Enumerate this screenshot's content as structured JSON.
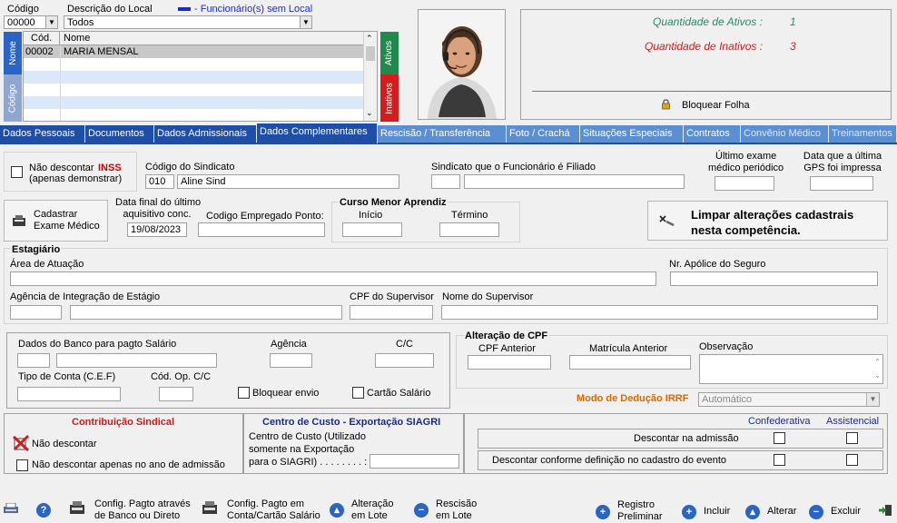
{
  "top": {
    "codigo_label": "Código",
    "codigo_value": "00000",
    "descricao_label": "Descrição do Local",
    "descricao_value": "Todos",
    "legend_text": "- Funcionário(s) sem Local",
    "legend_color": "#1a2fc8"
  },
  "grid": {
    "col_cod": "Cód.",
    "col_nome": "Nome",
    "rows": [
      {
        "cod": "00002",
        "nome": "MARIA MENSAL"
      }
    ],
    "side_tab_nome": "Nome",
    "side_tab_codigo": "Código",
    "side_tab_ativos": "Ativos",
    "side_tab_inativos": "Inativos"
  },
  "summary": {
    "ativos_label": "Quantidade de Ativos :",
    "ativos_value": "1",
    "inativos_label": "Quantidade de Inativos :",
    "inativos_value": "3",
    "bloquear_label": "Bloquear Folha"
  },
  "tabs": [
    {
      "label": "Dados Pessoais",
      "style": "dark"
    },
    {
      "label": "Documentos",
      "style": "dark"
    },
    {
      "label": "Dados Admissionais",
      "style": "dark"
    },
    {
      "label": "Dados Complementares",
      "style": "active"
    },
    {
      "label": "Rescisão / Transferência",
      "style": "light"
    },
    {
      "label": "Foto / Crachá",
      "style": "light"
    },
    {
      "label": "Situações Especiais",
      "style": "light"
    },
    {
      "label": "Contratos",
      "style": "light"
    },
    {
      "label": "Convênio Médico",
      "style": "faded"
    },
    {
      "label": "Treinamentos",
      "style": "faded"
    }
  ],
  "form": {
    "nao_descontar": "Não descontar",
    "inss": "INSS",
    "apenas_demonstrar": "(apenas demonstrar)",
    "codigo_sindicato_label": "Código do Sindicato",
    "codigo_sindicato_value": "010",
    "sindicato_nome_value": "Aline Sind",
    "sindicato_filiado_label": "Sindicato que o Funcionário é Filiado",
    "ultimo_exame_label_1": "Último exame",
    "ultimo_exame_label_2": "médico periódico",
    "gps_label_1": "Data que a última",
    "gps_label_2": "GPS foi impressa",
    "cadastrar_exame_1": "Cadastrar",
    "cadastrar_exame_2": "Exame Médico",
    "data_final_label_1": "Data final do último",
    "data_final_label_2": "aquisitivo conc.",
    "data_final_value": "19/08/2023",
    "codigo_ponto_label": "Codigo Empregado Ponto:",
    "curso_menor_label": "Curso Menor Aprendiz",
    "inicio_label": "Início",
    "termino_label": "Término",
    "limpar_1": "Limpar alterações cadastrais",
    "limpar_2": "nesta competência.",
    "estagiario_label": "Estagiário",
    "area_atuacao_label": "Área de Atuação",
    "apolice_label": "Nr. Apólice do Seguro",
    "agencia_integracao_label": "Agência de Integração de Estágio",
    "cpf_supervisor_label": "CPF do Supervisor",
    "nome_supervisor_label": "Nome do Supervisor",
    "banco_label": "Dados do Banco para pagto Salário",
    "agencia_label": "Agência",
    "cc_label": "C/C",
    "tipo_conta_label": "Tipo de Conta (C.E.F)",
    "cod_op_label": "Cód. Op. C/C",
    "bloquear_envio_label": "Bloquear envio",
    "cartao_salario_label": "Cartão Salário",
    "alteracao_cpf_label": "Alteração de CPF",
    "cpf_anterior_label": "CPF Anterior",
    "matricula_anterior_label": "Matrícula Anterior",
    "observacao_label": "Observação",
    "modo_irrf_label": "Modo de Dedução IRRF",
    "modo_irrf_value": "Automático",
    "contrib_sindical_label": "Contribuição Sindical",
    "contrib_nao_descontar": "Não descontar",
    "contrib_nao_descontar_ano": "Não descontar apenas no ano de admissão",
    "centro_custo_title": "Centro de Custo - Exportação SIAGRI",
    "centro_custo_l1": "Centro de Custo (Utilizado",
    "centro_custo_l2": "somente na Exportação",
    "centro_custo_l3": "para o SIAGRI) . . . . . . . . :",
    "confederativa_label": "Confederativa",
    "assistencial_label": "Assistencial",
    "descontar_admissao": "Descontar na admissão",
    "descontar_conforme": "Descontar conforme definição no cadastro do evento"
  },
  "toolbar": {
    "config_banco_1": "Config. Pagto através",
    "config_banco_2": "de Banco ou Direto",
    "config_conta_1": "Config. Pagto em",
    "config_conta_2": "Conta/Cartão Salário",
    "alteracao_1": "Alteração",
    "alteracao_2": "em Lote",
    "rescisao_1": "Rescisão",
    "rescisao_2": "em Lote",
    "registro_1": "Registro",
    "registro_2": "Preliminar",
    "incluir": "Incluir",
    "alterar": "Alterar",
    "excluir": "Excluir"
  },
  "colors": {
    "accent_blue": "#1e4ea8",
    "tab_light": "#5b8fd4",
    "inss_red": "#d40000",
    "summary_green": "#2a8a6a",
    "summary_red": "#d41c1c",
    "irrf_orange": "#d46a00",
    "heading_red": "#cc1b1b",
    "heading_blue": "#1a2a8a"
  }
}
